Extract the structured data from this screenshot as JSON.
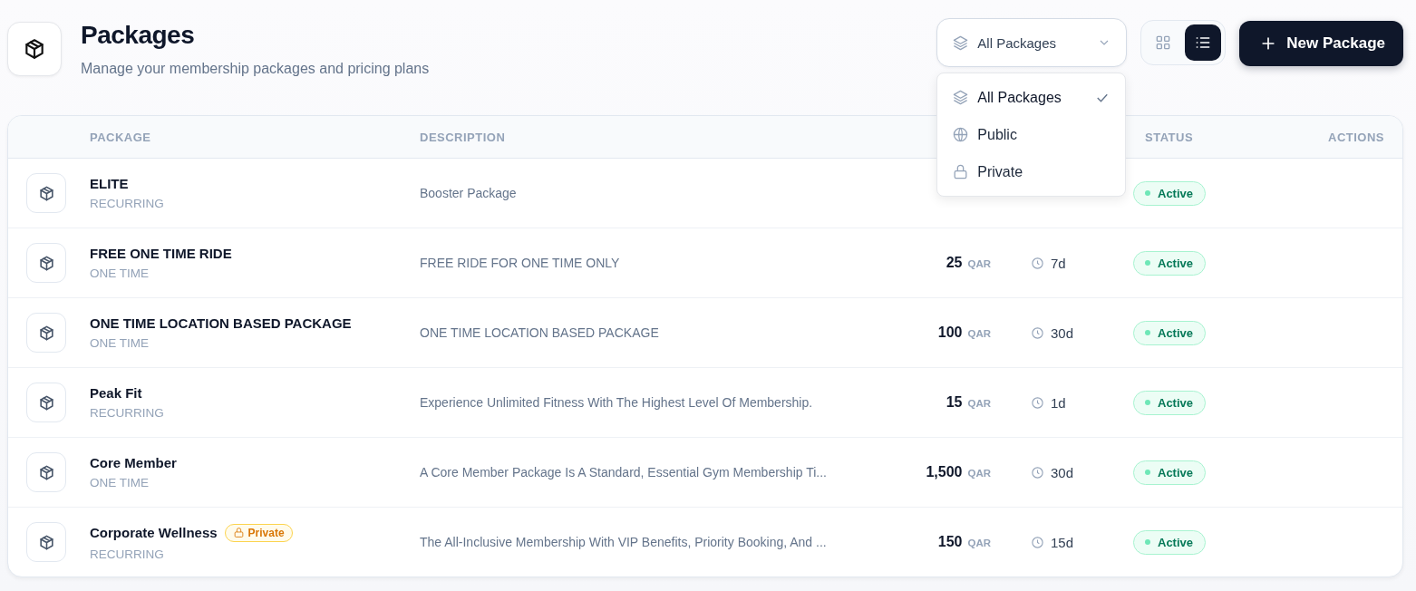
{
  "header": {
    "title": "Packages",
    "subtitle": "Manage your membership packages and pricing plans"
  },
  "filter": {
    "value": "All Packages",
    "expanded": true,
    "options": [
      {
        "kind": "all",
        "label": "All Packages",
        "selected": true
      },
      {
        "kind": "public",
        "label": "Public",
        "selected": false
      },
      {
        "kind": "private",
        "label": "Private",
        "selected": false
      }
    ]
  },
  "view_modes": [
    {
      "kind": "grid",
      "selected": false
    },
    {
      "kind": "list",
      "selected": true
    }
  ],
  "new_button": {
    "label": "New Package"
  },
  "table": {
    "columns": {
      "package": "PACKAGE",
      "description": "DESCRIPTION",
      "status": "STATUS",
      "actions": "ACTIONS"
    },
    "rows": [
      {
        "name": "ELITE",
        "type": "RECURRING",
        "description": "Booster Package",
        "status": "Active"
      },
      {
        "name": "FREE ONE TIME RIDE",
        "type": "ONE TIME",
        "description": "FREE RIDE FOR ONE TIME ONLY",
        "price": "25",
        "currency": "QAR",
        "duration": "7d",
        "status": "Active"
      },
      {
        "name": "ONE TIME LOCATION BASED PACKAGE",
        "type": "ONE TIME",
        "description": "ONE TIME LOCATION BASED PACKAGE",
        "price": "100",
        "currency": "QAR",
        "duration": "30d",
        "status": "Active"
      },
      {
        "name": "Peak Fit",
        "type": "RECURRING",
        "description": "Experience Unlimited Fitness With The Highest Level Of Membership.",
        "price": "15",
        "currency": "QAR",
        "duration": "1d",
        "status": "Active"
      },
      {
        "name": "Core Member",
        "type": "ONE TIME",
        "description": "A Core Member Package Is A Standard, Essential Gym Membership Ti...",
        "price": "1,500",
        "currency": "QAR",
        "duration": "30d",
        "status": "Active"
      },
      {
        "name": "Corporate Wellness",
        "badge": "Private",
        "type": "RECURRING",
        "description": "The All-Inclusive Membership With VIP Benefits, Priority Booking, And ...",
        "price": "150",
        "currency": "QAR",
        "duration": "15d",
        "status": "Active"
      }
    ]
  }
}
